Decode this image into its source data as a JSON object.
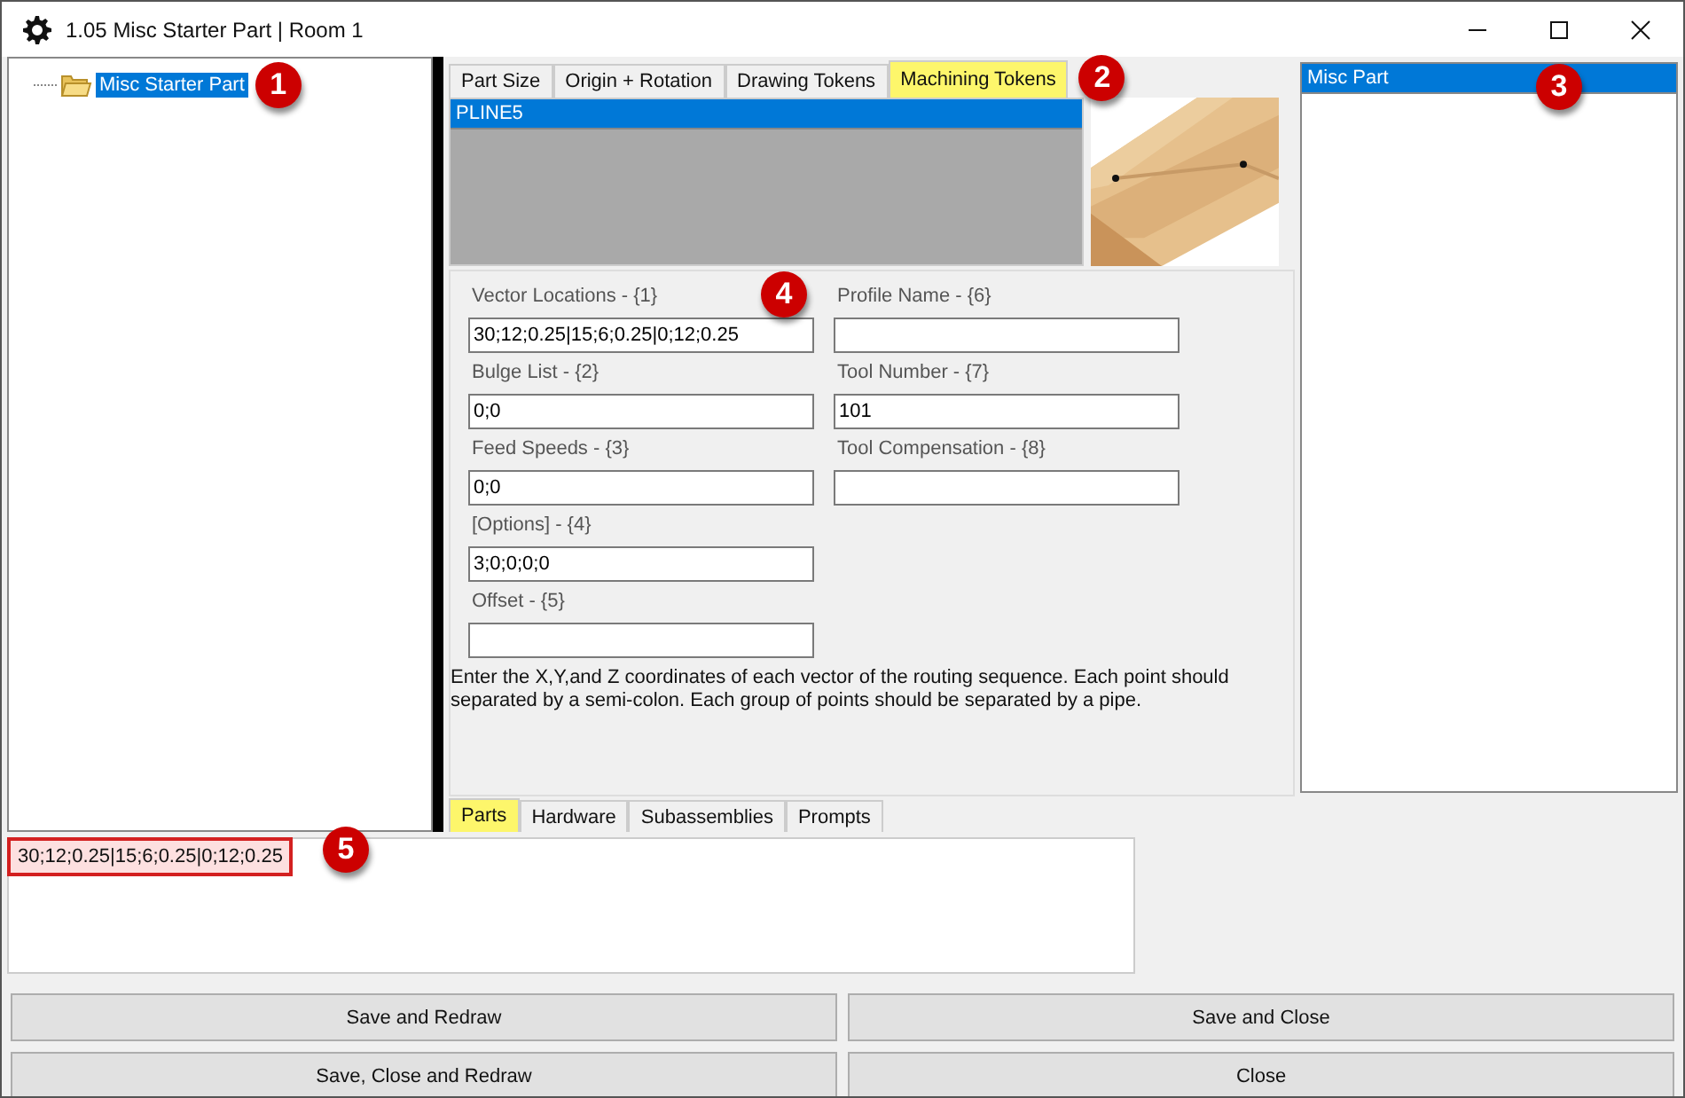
{
  "window": {
    "title": "1.05 Misc Starter Part | Room 1"
  },
  "tree": {
    "items": [
      {
        "label": "Misc Starter Part",
        "selected": true,
        "callout": "1"
      }
    ]
  },
  "token_tabs": [
    {
      "label": "Part  Size",
      "selected": false
    },
    {
      "label": "Origin + Rotation",
      "selected": false
    },
    {
      "label": "Drawing Tokens",
      "selected": false
    },
    {
      "label": "Machining Tokens",
      "selected": true,
      "callout": "2"
    }
  ],
  "token_list": {
    "items": [
      {
        "label": "PLINE5",
        "selected": true
      }
    ]
  },
  "form": {
    "left": [
      {
        "label": "Vector Locations - {1}",
        "value": "30;12;0.25|15;6;0.25|0;12;0.25",
        "callout": "4"
      },
      {
        "label": "Bulge List - {2}",
        "value": "0;0"
      },
      {
        "label": "Feed Speeds - {3}",
        "value": "0;0"
      },
      {
        "label": "[Options] - {4}",
        "value": "3;0;0;0;0"
      },
      {
        "label": "Offset - {5}"
      }
    ],
    "right": [
      {
        "label": "Profile Name - {6}"
      },
      {
        "label": "Tool Number - {7}",
        "value": "101"
      },
      {
        "label": "Tool Compensation - {8}"
      }
    ],
    "help": "Enter the X,Y,and Z coordinates of each vector of the routing sequence. Each point should separated by a semi-colon. Each group of points should be separated by a pipe."
  },
  "part_list": {
    "items": [
      {
        "label": "Misc Part",
        "selected": true
      }
    ],
    "callout": "3"
  },
  "bottom_tabs": [
    {
      "label": "Parts",
      "selected": true
    },
    {
      "label": "Hardware",
      "selected": false
    },
    {
      "label": "Subassemblies",
      "selected": false
    },
    {
      "label": "Prompts",
      "selected": false
    }
  ],
  "output": {
    "value": "30;12;0.25|15;6;0.25|0;12;0.25",
    "highlighted": true,
    "callout": "5"
  },
  "buttons": [
    {
      "label": "Save and Redraw"
    },
    {
      "label": "Save and Close"
    },
    {
      "label": "Save, Close and Redraw"
    },
    {
      "label": "Close"
    }
  ]
}
